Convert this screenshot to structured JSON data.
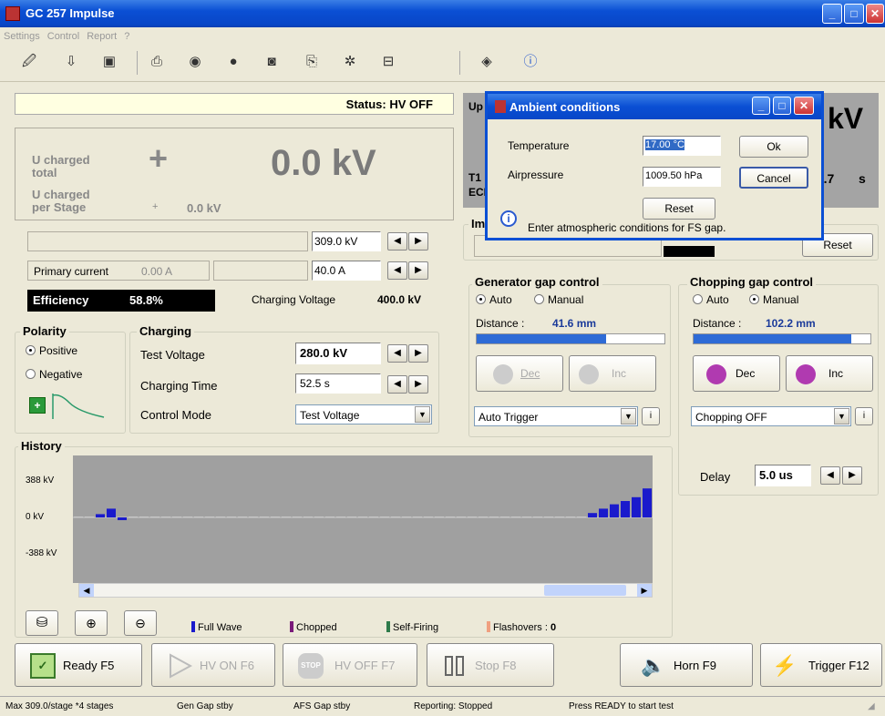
{
  "window": {
    "title": "GC 257 Impulse"
  },
  "menu": [
    "Settings",
    "Control",
    "Report",
    "?"
  ],
  "toolbar": {
    "icons": [
      "open-icon",
      "import-icon",
      "save-icon",
      "print-icon",
      "preview-icon",
      "stop-icon",
      "camera-icon",
      "report-icon",
      "gear-icon",
      "window-icon",
      "book-icon",
      "info-icon"
    ]
  },
  "status": {
    "text": "Status: HV OFF"
  },
  "charged": {
    "total_label": "U charged\ntotal",
    "total_sign": "+",
    "total_value": "0.0 kV",
    "stage_label": "U charged\nper Stage",
    "stage_sign": "+",
    "stage_value": "0.0 kV"
  },
  "limits": {
    "voltage": "309.0 kV",
    "current": "40.0 A"
  },
  "primary": {
    "label": "Primary current",
    "value": "0.00 A"
  },
  "efficiency": {
    "label": "Efficiency",
    "value": "58.8%",
    "cv_label": "Charging Voltage",
    "cv_value": "400.0 kV"
  },
  "polarity": {
    "title": "Polarity",
    "positive": "Positive",
    "negative": "Negative"
  },
  "charging": {
    "title": "Charging",
    "test_voltage_label": "Test Voltage",
    "test_voltage": "280.0 kV",
    "time_label": "Charging Time",
    "time": "52.5 s",
    "mode_label": "Control Mode",
    "mode": "Test Voltage"
  },
  "right_top": {
    "up": "Up",
    "kv": "kV",
    "t1": "T1",
    "ec": "ECI",
    "time": "64.7",
    "s": "s",
    "im": "Im",
    "reset": "Reset"
  },
  "gen_gap": {
    "title": "Generator gap control",
    "auto": "Auto",
    "manual": "Manual",
    "distance_label": "Distance :",
    "distance": "41.6 mm",
    "distance_frac": 0.69,
    "dec": "Dec",
    "inc": "Inc",
    "trigger": "Auto Trigger"
  },
  "chop_gap": {
    "title": "Chopping gap control",
    "auto": "Auto",
    "manual": "Manual",
    "distance_label": "Distance :",
    "distance": "102.2 mm",
    "distance_frac": 0.89,
    "dec": "Dec",
    "inc": "Inc",
    "mode": "Chopping OFF",
    "delay_label": "Delay",
    "delay": "5.0 us"
  },
  "history": {
    "title": "History",
    "y_labels": [
      "388 kV",
      "0 kV",
      "-388 kV"
    ],
    "legend": {
      "full": "Full Wave",
      "chopped": "Chopped",
      "self": "Self-Firing",
      "flash": "Flashovers :",
      "flash_count": "0"
    },
    "colors": {
      "full": "#1a1acc",
      "chopped": "#7a1a7a",
      "self": "#2e7a4a",
      "flash": "#f0a080"
    }
  },
  "history_bars": [
    0,
    0,
    0.06,
    0.16,
    -0.05,
    0,
    0,
    0,
    0,
    0,
    0,
    0,
    0,
    0,
    0,
    0,
    0,
    0,
    0,
    0,
    0,
    0,
    0,
    0,
    0,
    0,
    0,
    0,
    0,
    0,
    0,
    0,
    0,
    0,
    0,
    0,
    0,
    0,
    0,
    0,
    0,
    0,
    0,
    0,
    0,
    0,
    0,
    0.08,
    0.16,
    0.24,
    0.3,
    0.37,
    0.53
  ],
  "buttons": {
    "ready": "Ready  F5",
    "hvon": "HV ON  F6",
    "hvoff": "HV OFF  F7",
    "stop": "Stop F8",
    "horn": "Horn  F9",
    "trigger": "Trigger F12"
  },
  "statusbar": [
    "Max 309.0/stage *4 stages",
    "Gen Gap stby",
    "AFS Gap stby",
    "Reporting: Stopped",
    "Press READY to start test"
  ],
  "dialog": {
    "title": "Ambient conditions",
    "temp_label": "Temperature",
    "temp": "17.00 °C",
    "press_label": "Airpressure",
    "press": "1009.50 hPa",
    "ok": "Ok",
    "cancel": "Cancel",
    "reset": "Reset",
    "info": "Enter atmospheric conditions for FS gap."
  }
}
